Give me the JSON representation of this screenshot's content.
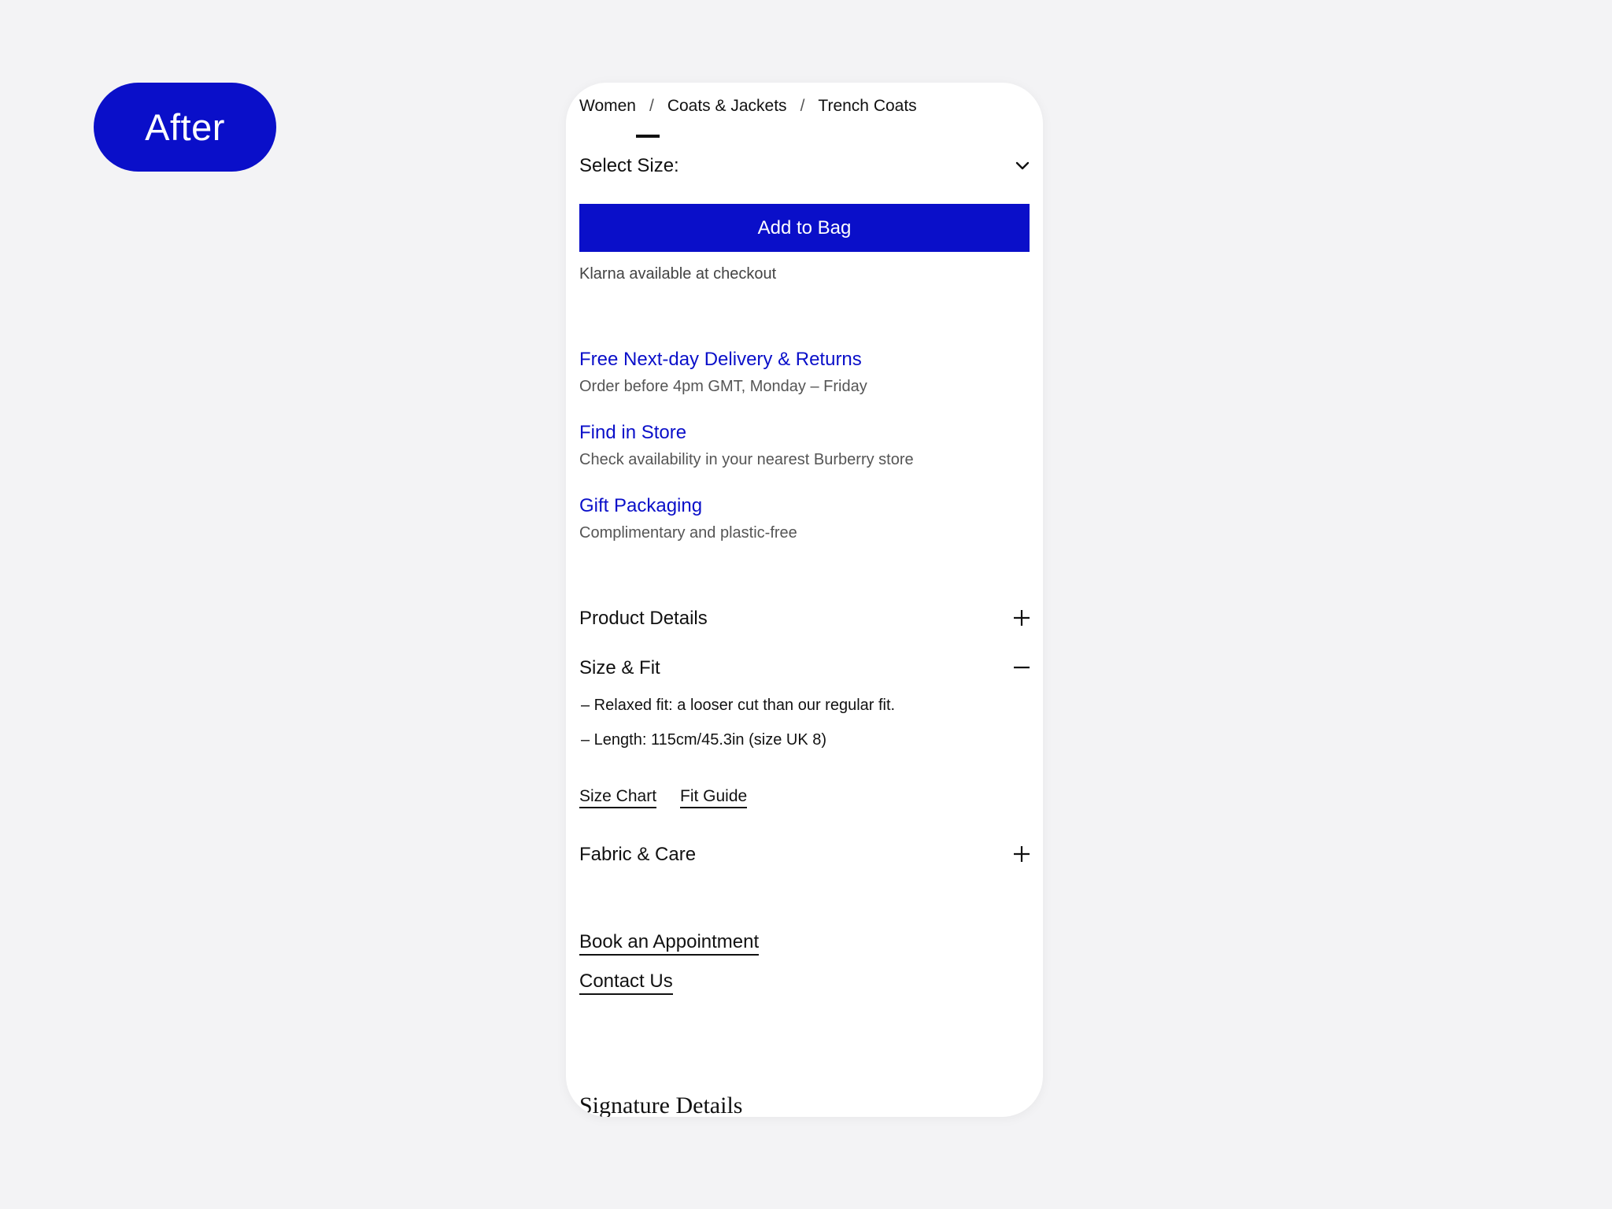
{
  "badge": {
    "label": "After"
  },
  "breadcrumb": {
    "items": [
      "Women",
      "Coats & Jackets",
      "Trench Coats"
    ],
    "separator": "/"
  },
  "size_select": {
    "label": "Select Size:",
    "icon": "chevron-down-icon"
  },
  "add_to_bag": {
    "label": "Add to Bag"
  },
  "klarna": {
    "text": "Klarna available at checkout"
  },
  "services": [
    {
      "title": "Free Next-day Delivery & Returns",
      "subtitle": "Order before 4pm GMT, Monday – Friday"
    },
    {
      "title": "Find in Store",
      "subtitle": "Check availability in your nearest Burberry store"
    },
    {
      "title": "Gift Packaging",
      "subtitle": "Complimentary and plastic-free"
    }
  ],
  "accordions": {
    "product_details": {
      "title": "Product Details",
      "icon": "plus-icon"
    },
    "size_fit": {
      "title": "Size & Fit",
      "icon": "minus-icon",
      "lines": [
        "– Relaxed fit: a looser cut than our regular fit.",
        "– Length: 115cm/45.3in (size UK 8)"
      ],
      "links": [
        "Size Chart",
        "Fit Guide"
      ]
    },
    "fabric_care": {
      "title": "Fabric & Care",
      "icon": "plus-icon"
    }
  },
  "bottom_links": [
    "Book an Appointment",
    "Contact Us"
  ],
  "signature": {
    "title": "Signature Details"
  },
  "colors": {
    "accent": "#0a0fc9",
    "background": "#f3f3f5",
    "card": "#ffffff"
  }
}
